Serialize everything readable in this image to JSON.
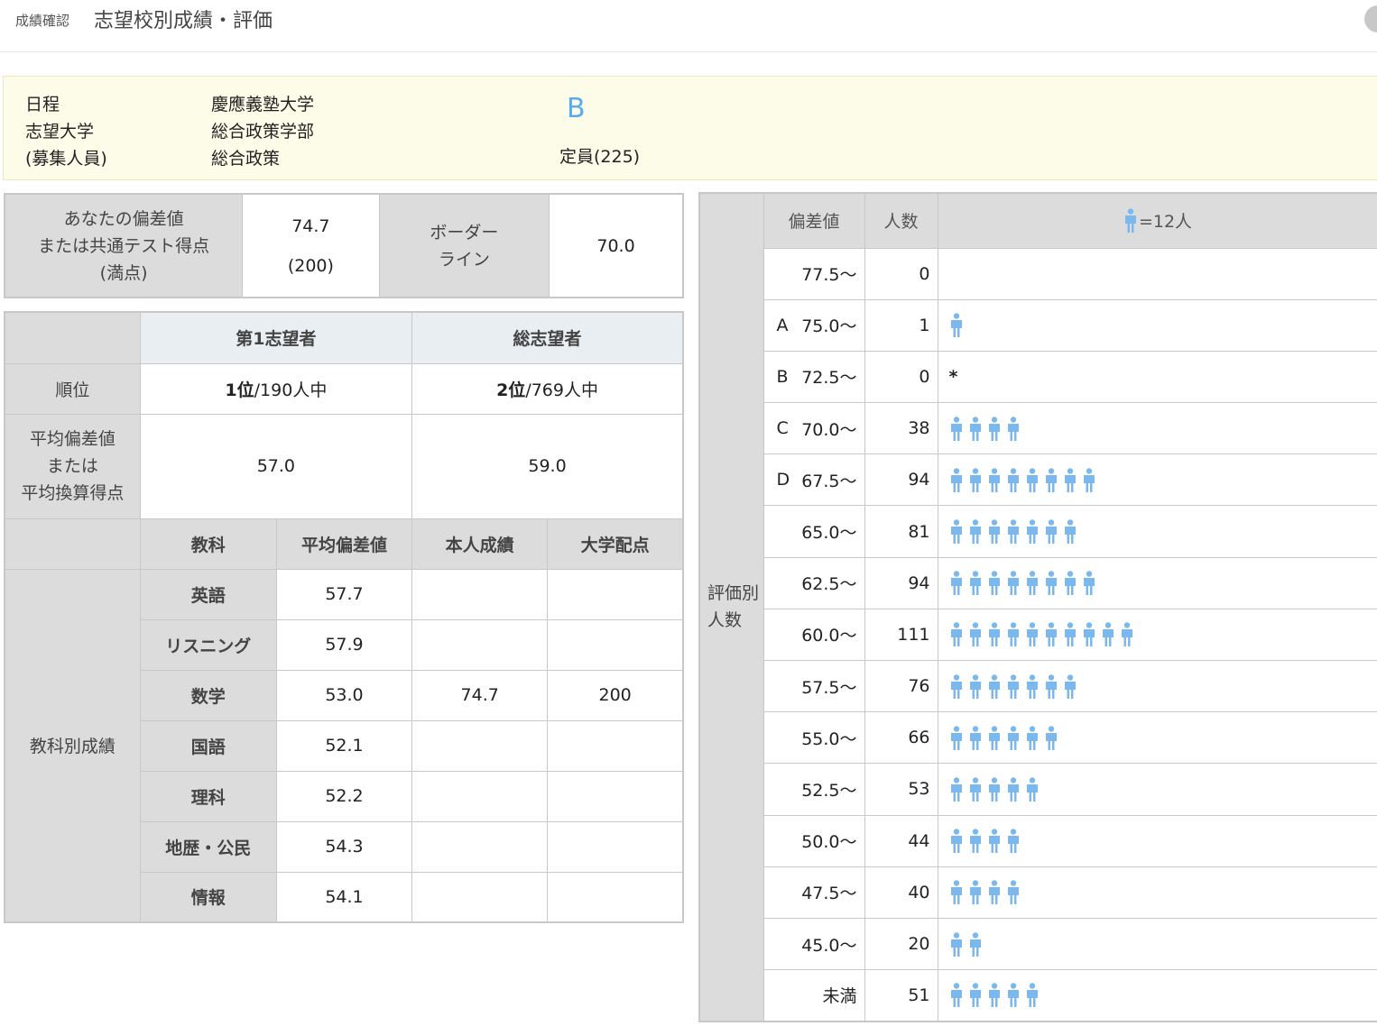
{
  "header": {
    "breadcrumb": "成績確認",
    "title": "志望校別成績・評価"
  },
  "info": {
    "labels": [
      "日程",
      "志望大学",
      "(募集人員)"
    ],
    "university": "慶應義塾大学",
    "faculty": "総合政策学部",
    "department": "総合政策",
    "grade": "B",
    "capacity": "定員(225)"
  },
  "score": {
    "label_line1": "あなたの偏差値",
    "label_line2": "または共通テスト得点",
    "label_line3": "(満点)",
    "value": "74.7",
    "full": "(200)",
    "border_line1": "ボーダー",
    "border_line2": "ライン",
    "border_value": "70.0"
  },
  "rank_table": {
    "col_first": "第1志望者",
    "col_total": "総志望者",
    "rank_label": "順位",
    "rank_first_num": "1位",
    "rank_first_rest": "/190人中",
    "rank_total_num": "2位",
    "rank_total_rest": "/769人中",
    "avg_label_line1": "平均偏差値",
    "avg_label_line2": "または",
    "avg_label_line3": "平均換算得点",
    "avg_first": "57.0",
    "avg_total": "59.0"
  },
  "subjects": {
    "section_label": "教科別成績",
    "headers": [
      "教科",
      "平均偏差値",
      "本人成績",
      "大学配点"
    ],
    "rows": [
      {
        "name": "英語",
        "avg": "57.7",
        "mine": "",
        "points": ""
      },
      {
        "name": "リスニング",
        "avg": "57.9",
        "mine": "",
        "points": ""
      },
      {
        "name": "数学",
        "avg": "53.0",
        "mine": "74.7",
        "points": "200"
      },
      {
        "name": "国語",
        "avg": "52.1",
        "mine": "",
        "points": ""
      },
      {
        "name": "理科",
        "avg": "52.2",
        "mine": "",
        "points": ""
      },
      {
        "name": "地歴・公民",
        "avg": "54.3",
        "mine": "",
        "points": ""
      },
      {
        "name": "情報",
        "avg": "54.1",
        "mine": "",
        "points": ""
      }
    ]
  },
  "distribution": {
    "side_line1": "評価別",
    "side_line2": "人数",
    "header_dev": "偏差値",
    "header_count": "人数",
    "legend": "=12人",
    "icon_color": "#7ab8ee",
    "rows": [
      {
        "grade": "",
        "range": "77.5〜",
        "count": "0",
        "icons": 0,
        "mark": ""
      },
      {
        "grade": "A",
        "range": "75.0〜",
        "count": "1",
        "icons": 1,
        "mark": ""
      },
      {
        "grade": "B",
        "range": "72.5〜",
        "count": "0",
        "icons": 0,
        "mark": "*"
      },
      {
        "grade": "C",
        "range": "70.0〜",
        "count": "38",
        "icons": 4,
        "mark": ""
      },
      {
        "grade": "D",
        "range": "67.5〜",
        "count": "94",
        "icons": 8,
        "mark": ""
      },
      {
        "grade": "",
        "range": "65.0〜",
        "count": "81",
        "icons": 7,
        "mark": ""
      },
      {
        "grade": "",
        "range": "62.5〜",
        "count": "94",
        "icons": 8,
        "mark": ""
      },
      {
        "grade": "",
        "range": "60.0〜",
        "count": "111",
        "icons": 10,
        "mark": ""
      },
      {
        "grade": "",
        "range": "57.5〜",
        "count": "76",
        "icons": 7,
        "mark": ""
      },
      {
        "grade": "",
        "range": "55.0〜",
        "count": "66",
        "icons": 6,
        "mark": ""
      },
      {
        "grade": "",
        "range": "52.5〜",
        "count": "53",
        "icons": 5,
        "mark": ""
      },
      {
        "grade": "",
        "range": "50.0〜",
        "count": "44",
        "icons": 4,
        "mark": ""
      },
      {
        "grade": "",
        "range": "47.5〜",
        "count": "40",
        "icons": 4,
        "mark": ""
      },
      {
        "grade": "",
        "range": "45.0〜",
        "count": "20",
        "icons": 2,
        "mark": ""
      },
      {
        "grade": "",
        "range": "未満",
        "count": "51",
        "icons": 5,
        "mark": ""
      }
    ]
  }
}
